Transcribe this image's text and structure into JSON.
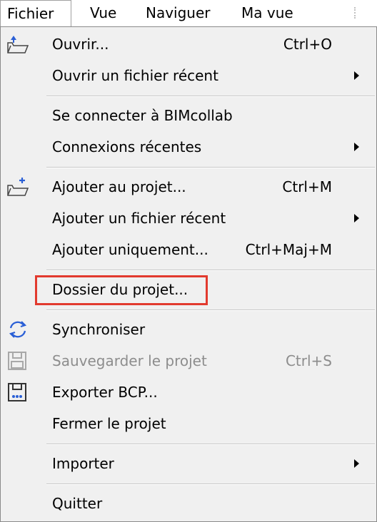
{
  "menubar": {
    "items": [
      {
        "label": "Fichier"
      },
      {
        "label": "Vue"
      },
      {
        "label": "Naviguer"
      },
      {
        "label": "Ma vue"
      }
    ]
  },
  "menu": {
    "items": [
      {
        "label": "Ouvrir...",
        "shortcut": "Ctrl+O",
        "icon": "open-folder-icon"
      },
      {
        "label": "Ouvrir un fichier récent",
        "submenu": true
      },
      {
        "label": "Se connecter à BIMcollab"
      },
      {
        "label": "Connexions récentes",
        "submenu": true
      },
      {
        "label": "Ajouter au projet...",
        "shortcut": "Ctrl+M",
        "icon": "add-folder-icon"
      },
      {
        "label": "Ajouter un fichier récent",
        "submenu": true
      },
      {
        "label": "Ajouter uniquement...",
        "shortcut": "Ctrl+Maj+M"
      },
      {
        "label": "Dossier du projet..."
      },
      {
        "label": "Synchroniser",
        "icon": "sync-icon"
      },
      {
        "label": "Sauvegarder le projet",
        "shortcut": "Ctrl+S",
        "disabled": true,
        "icon": "save-icon"
      },
      {
        "label": "Exporter BCP...",
        "icon": "export-icon"
      },
      {
        "label": "Fermer le projet"
      },
      {
        "label": "Importer",
        "submenu": true
      },
      {
        "label": "Quitter"
      }
    ]
  },
  "colors": {
    "highlight_border": "#e23a2e",
    "icon_blue": "#2a5fd6",
    "disabled_text": "#8d8d8d"
  }
}
